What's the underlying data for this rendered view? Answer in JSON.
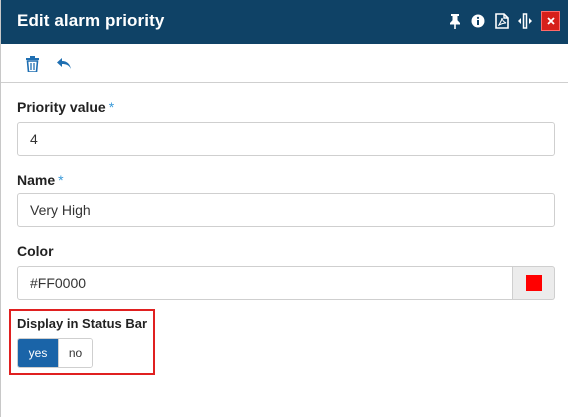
{
  "header": {
    "title": "Edit alarm priority",
    "icons": [
      "pin-icon",
      "info-icon",
      "pdf-icon",
      "resize-horizontal-icon",
      "close-icon"
    ],
    "close_color": "#d6201a",
    "background": "#0f4266"
  },
  "toolbar": {
    "icons": [
      "trash-icon",
      "undo-icon"
    ],
    "icon_color": "#1f6fb2"
  },
  "form": {
    "priority": {
      "label": "Priority value",
      "required_mark": "*",
      "value": "4"
    },
    "name": {
      "label": "Name",
      "required_mark": "*",
      "value": "Very High"
    },
    "color": {
      "label": "Color",
      "value": "#FF0000",
      "swatch": "#FF0000"
    },
    "status_bar": {
      "label": "Display in Status Bar",
      "options": [
        "yes",
        "no"
      ],
      "selected": "yes"
    }
  },
  "highlight_color": "#e02020"
}
